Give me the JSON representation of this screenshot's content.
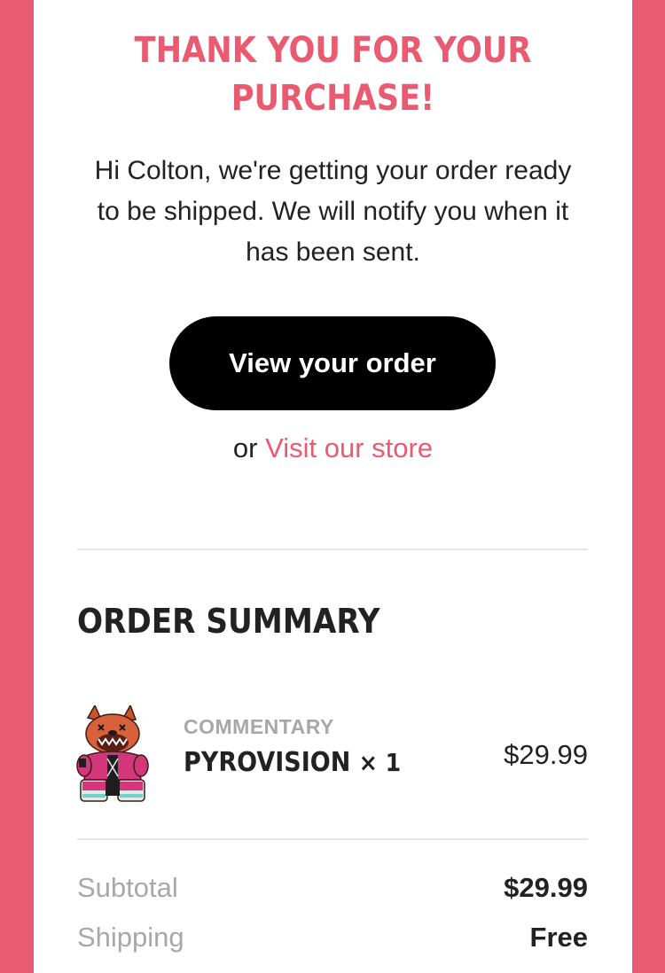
{
  "header": {
    "title": "THANK YOU FOR YOUR PURCHASE!"
  },
  "intro": {
    "message": "Hi Colton, we're getting your order ready to be shipped. We will notify you when it has been sent."
  },
  "actions": {
    "view_order_label": "View your order",
    "or_text": "or",
    "visit_store_label": "Visit our store"
  },
  "summary": {
    "title": "ORDER SUMMARY",
    "items": [
      {
        "vendor": "COMMENTARY",
        "name": "PYROVISION",
        "quantity": "× 1",
        "price": "$29.99",
        "icon": "pyrovision-plush-thumbnail"
      }
    ],
    "totals": {
      "subtotal_label": "Subtotal",
      "subtotal_value": "$29.99",
      "shipping_label": "Shipping",
      "shipping_value": "Free"
    }
  },
  "colors": {
    "brand": "#ea5a70",
    "text": "#222222",
    "muted": "#a8a8a8",
    "button": "#000000"
  }
}
